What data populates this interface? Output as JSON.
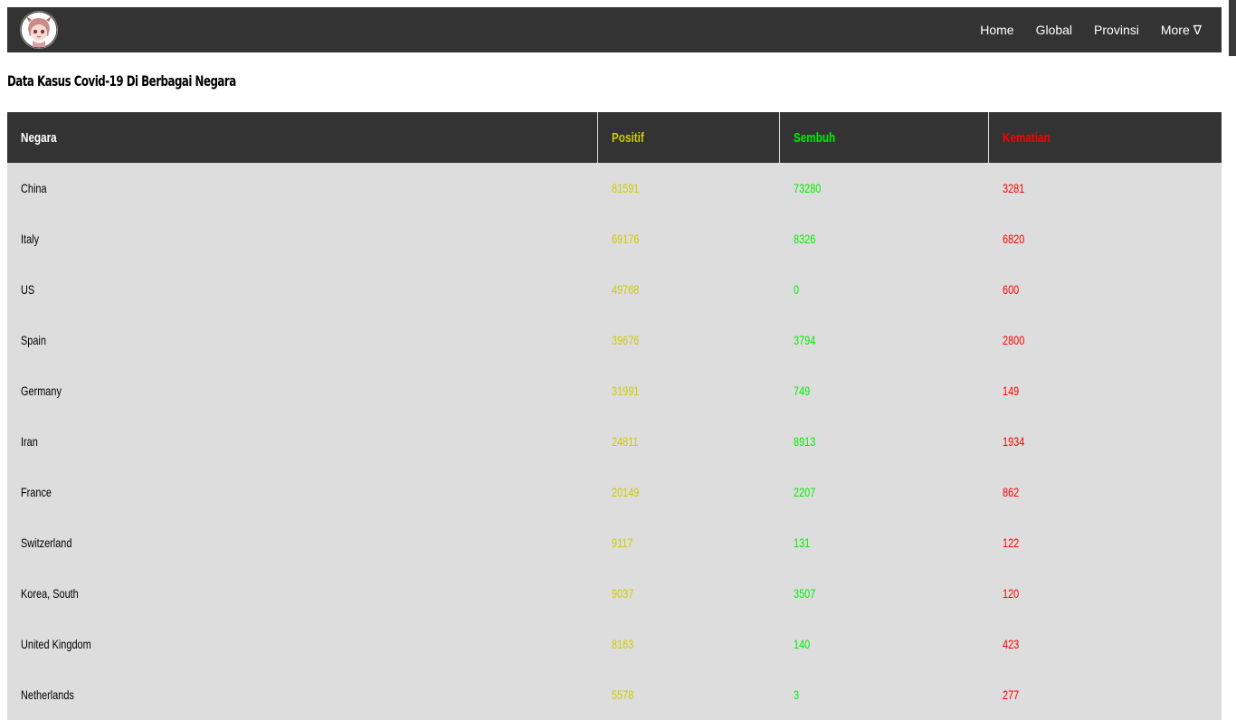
{
  "nav": {
    "links": [
      "Home",
      "Global",
      "Provinsi",
      "More ∇"
    ]
  },
  "page": {
    "title": "Data Kasus Covid-19 Di Berbagai Negara"
  },
  "table": {
    "headers": {
      "negara": "Negara",
      "positif": "Positif",
      "sembuh": "Sembuh",
      "kematian": "Kematian"
    },
    "rows": [
      {
        "negara": "China",
        "positif": "81591",
        "sembuh": "73280",
        "kematian": "3281"
      },
      {
        "negara": "Italy",
        "positif": "69176",
        "sembuh": "8326",
        "kematian": "6820"
      },
      {
        "negara": "US",
        "positif": "49768",
        "sembuh": "0",
        "kematian": "600"
      },
      {
        "negara": "Spain",
        "positif": "39676",
        "sembuh": "3794",
        "kematian": "2800"
      },
      {
        "negara": "Germany",
        "positif": "31991",
        "sembuh": "749",
        "kematian": "149"
      },
      {
        "negara": "Iran",
        "positif": "24811",
        "sembuh": "8913",
        "kematian": "1934"
      },
      {
        "negara": "France",
        "positif": "20149",
        "sembuh": "2207",
        "kematian": "862"
      },
      {
        "negara": "Switzerland",
        "positif": "9117",
        "sembuh": "131",
        "kematian": "122"
      },
      {
        "negara": "Korea, South",
        "positif": "9037",
        "sembuh": "3507",
        "kematian": "120"
      },
      {
        "negara": "United Kingdom",
        "positif": "8163",
        "sembuh": "140",
        "kematian": "423"
      },
      {
        "negara": "Netherlands",
        "positif": "5578",
        "sembuh": "3",
        "kematian": "277"
      }
    ]
  },
  "colors": {
    "navbar": "#333333",
    "row_bg": "#dddddd",
    "positif": "#cccc00",
    "sembuh": "#00ee00",
    "kematian": "#ff0000"
  },
  "icons": {
    "logo": "anime-avatar-logo"
  }
}
